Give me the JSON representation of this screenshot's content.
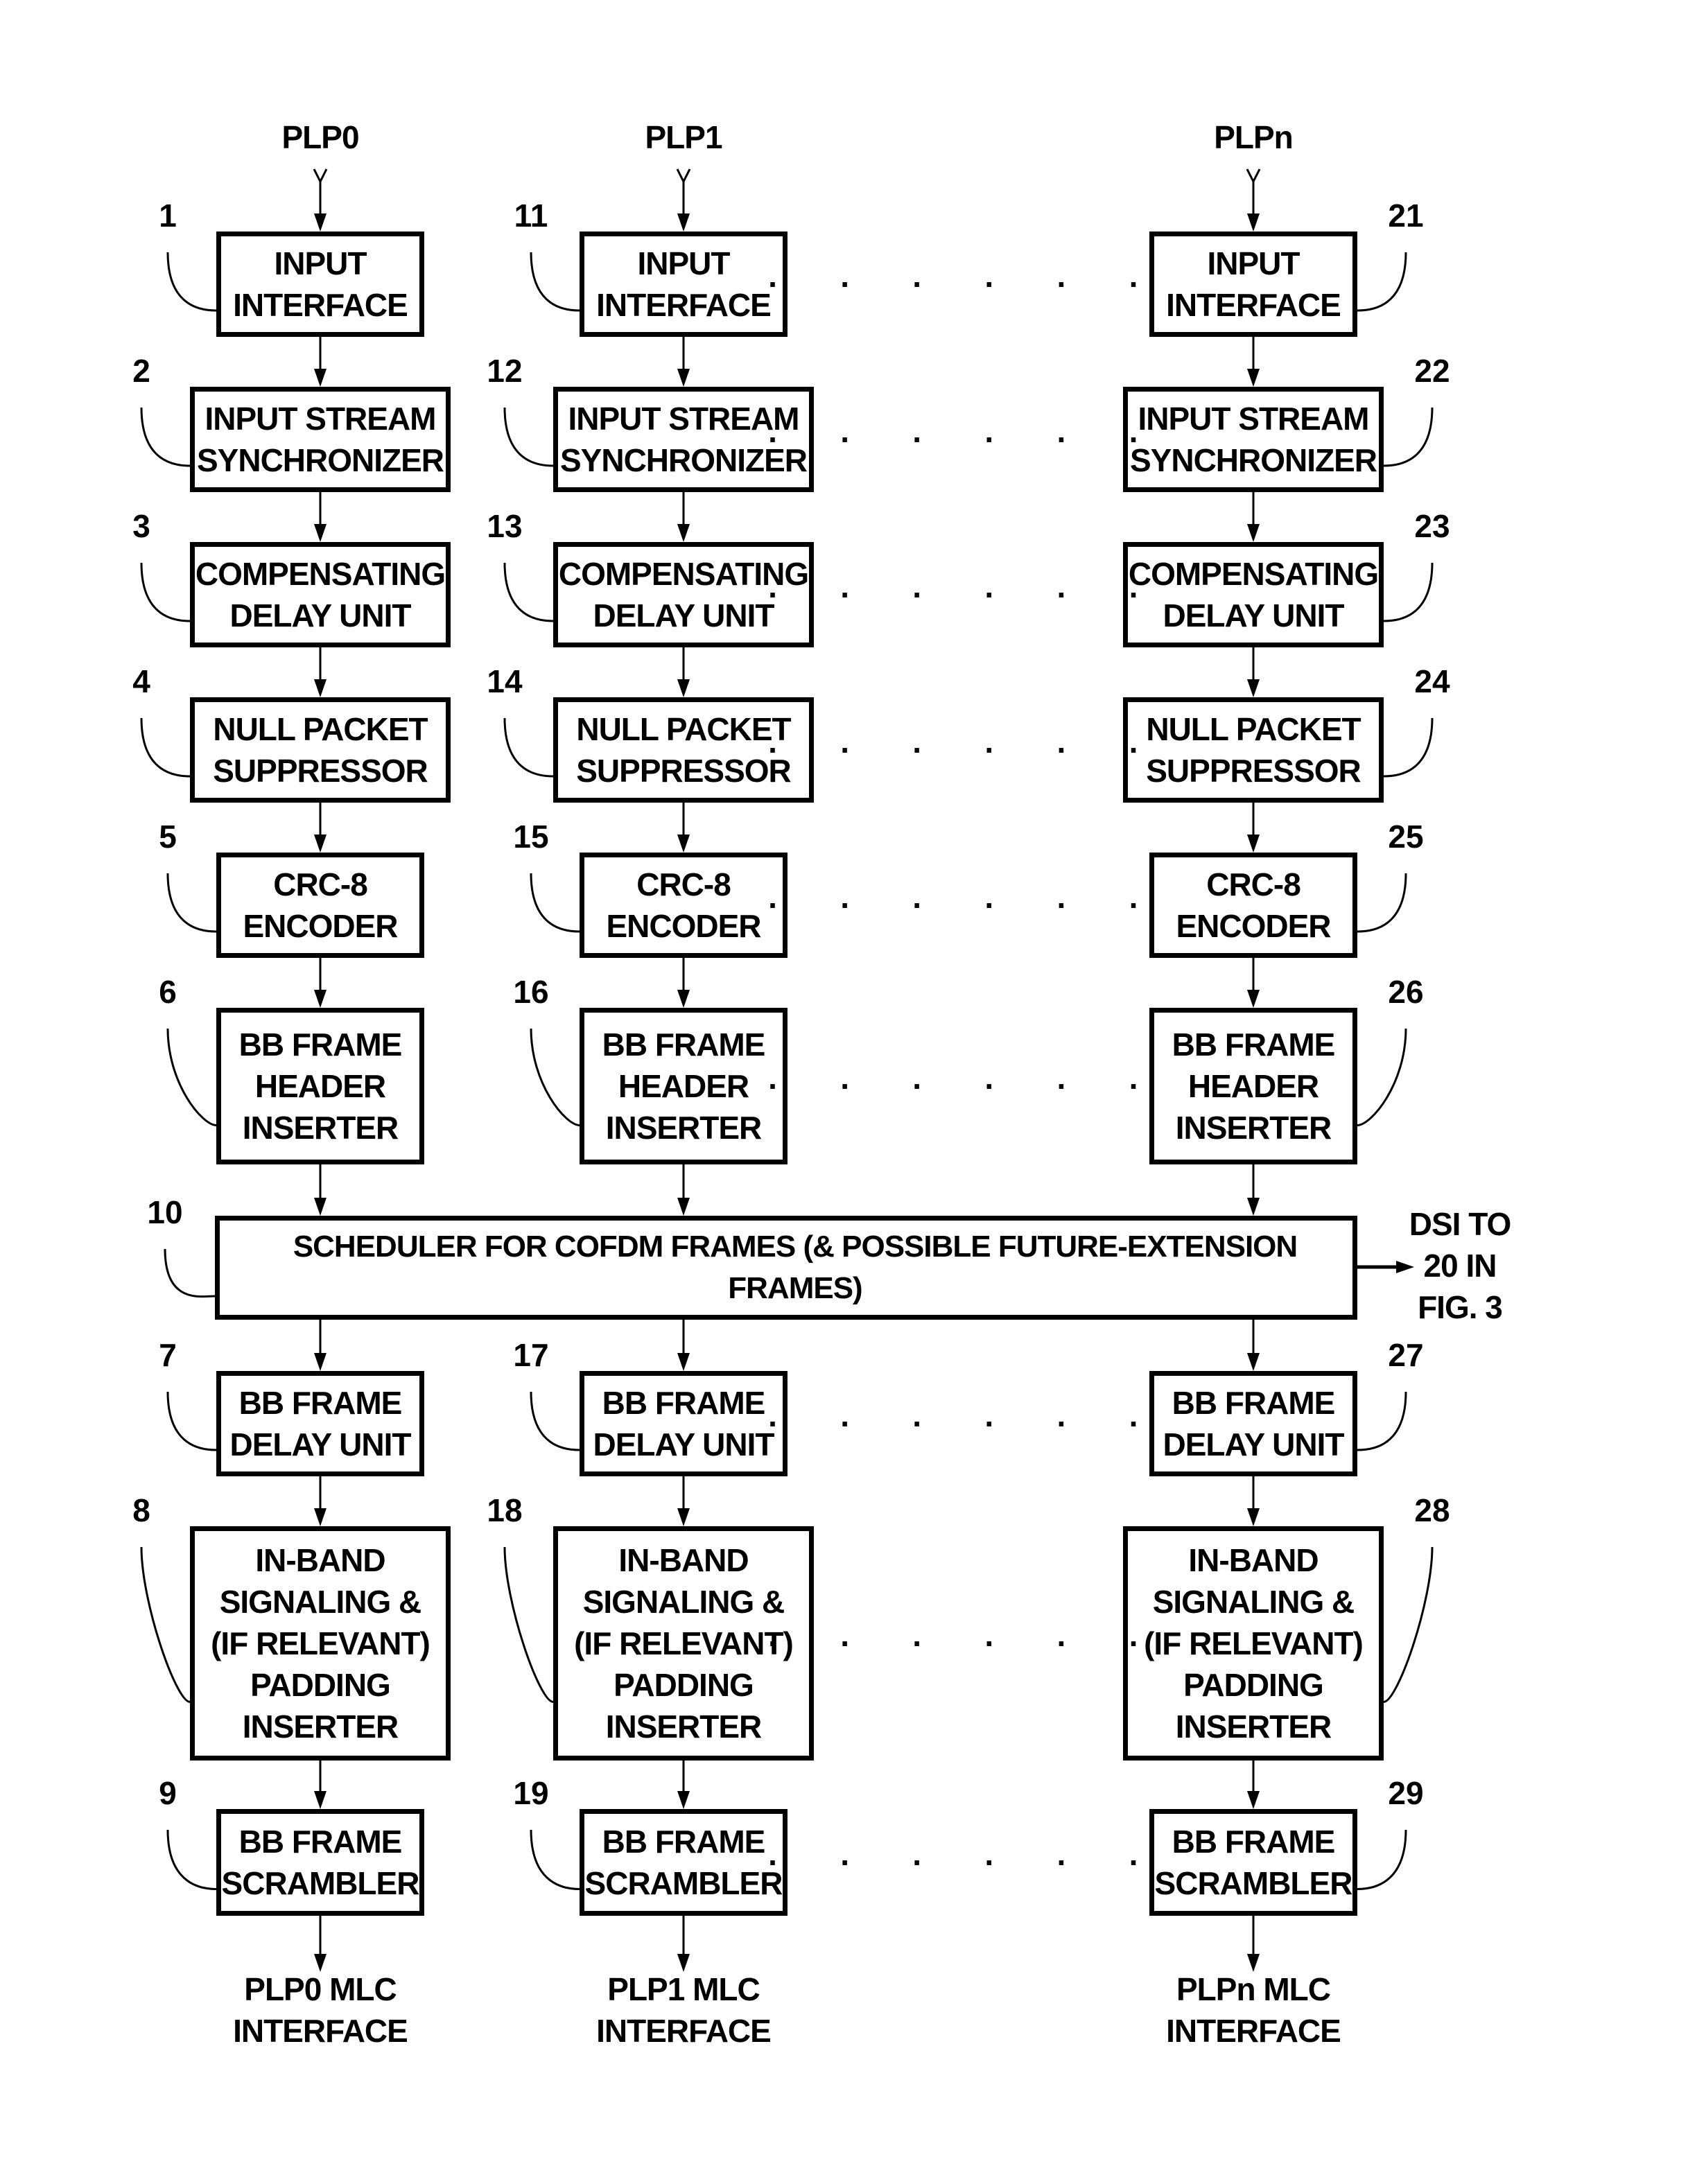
{
  "columns": [
    {
      "input_label": "PLP0",
      "output_label": "PLP0 MLC\nINTERFACE",
      "refs": [
        "1",
        "2",
        "3",
        "4",
        "5",
        "6",
        "7",
        "8",
        "9"
      ]
    },
    {
      "input_label": "PLP1",
      "output_label": "PLP1 MLC\nINTERFACE",
      "refs": [
        "11",
        "12",
        "13",
        "14",
        "15",
        "16",
        "17",
        "18",
        "19"
      ]
    },
    {
      "input_label": "PLPn",
      "output_label": "PLPn MLC\nINTERFACE",
      "refs": [
        "21",
        "22",
        "23",
        "24",
        "25",
        "26",
        "27",
        "28",
        "29"
      ]
    }
  ],
  "blocks": [
    "INPUT\nINTERFACE",
    "INPUT STREAM\nSYNCHRONIZER",
    "COMPENSATING\nDELAY UNIT",
    "NULL PACKET\nSUPPRESSOR",
    "CRC-8\nENCODER",
    "BB FRAME\nHEADER\nINSERTER",
    "BB FRAME\nDELAY UNIT",
    "IN-BAND\nSIGNALING &\n(IF RELEVANT)\nPADDING\nINSERTER",
    "BB FRAME\nSCRAMBLER"
  ],
  "scheduler": {
    "ref": "10",
    "label": "SCHEDULER FOR COFDM FRAMES (& POSSIBLE FUTURE-EXTENSION FRAMES)",
    "output_label": "DSI TO\n20 IN\nFIG. 3"
  },
  "ellipsis": "· · · · · ·"
}
